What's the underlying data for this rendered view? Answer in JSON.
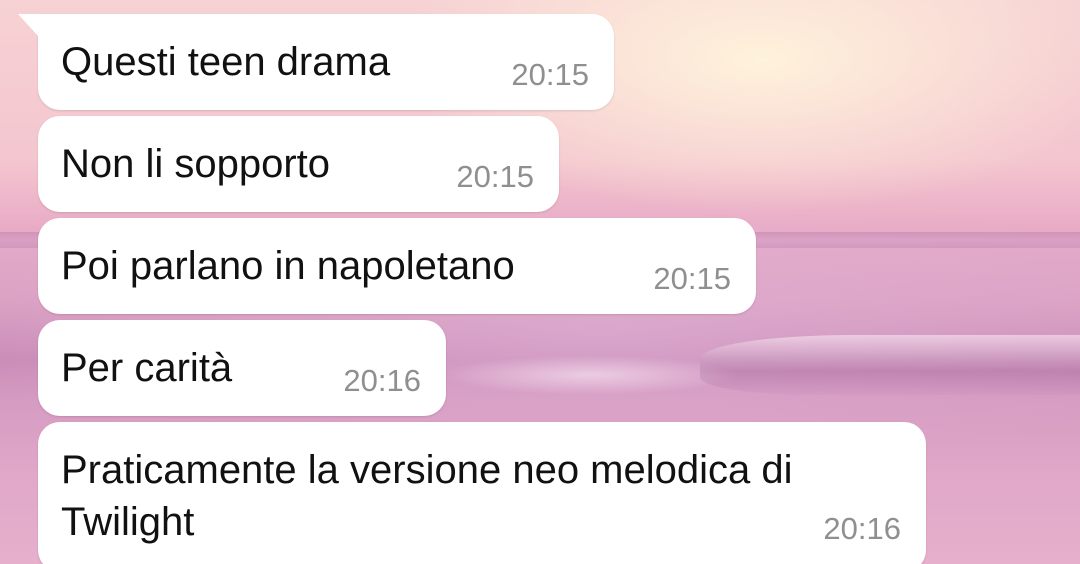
{
  "conversation": {
    "messages": [
      {
        "text": "Questi teen drama",
        "time": "20:15"
      },
      {
        "text": "Non li sopporto",
        "time": "20:15"
      },
      {
        "text": "Poi parlano in napoletano",
        "time": "20:15"
      },
      {
        "text": "Per carità",
        "time": "20:16"
      },
      {
        "text": "Praticamente la versione neo melodica di\nTwilight",
        "time": "20:16"
      }
    ]
  },
  "colors": {
    "bubble_background": "#ffffff",
    "message_text": "#111111",
    "timestamp_text": "#8f8f8f",
    "wallpaper_tint": "#e0a7c9"
  },
  "icons": {
    "bubble_tail": "incoming-bubble-tail-icon"
  }
}
